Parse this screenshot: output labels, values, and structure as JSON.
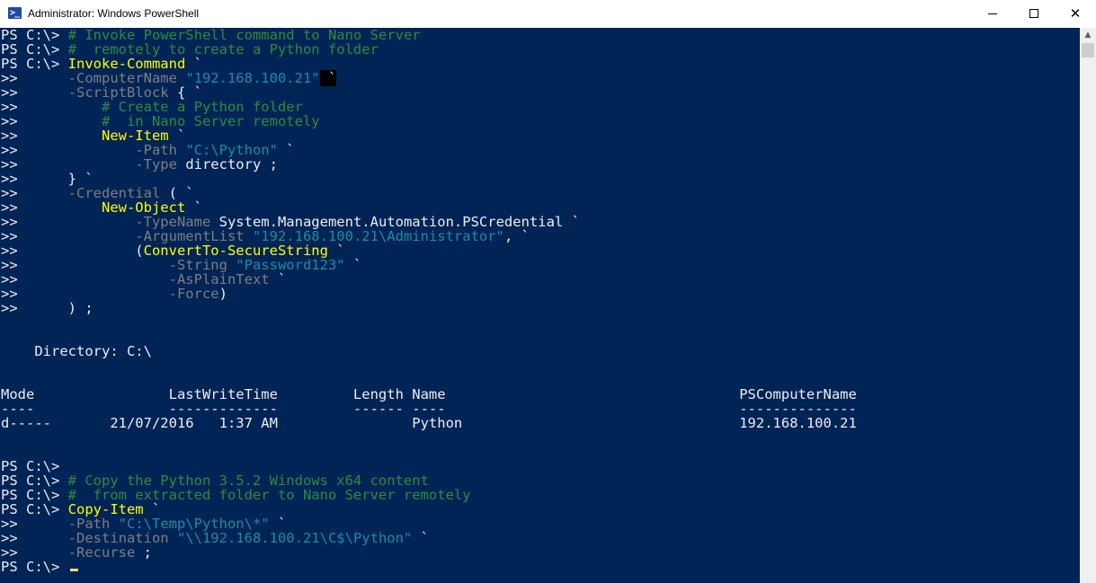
{
  "window": {
    "title": "Administrator: Windows PowerShell",
    "app_icon_glyph": ">_",
    "buttons": {
      "minimize": "minimize",
      "maximize": "maximize",
      "close": "✕"
    }
  },
  "colors": {
    "console_bg": "#012456",
    "default_text": "#eeedf0",
    "comment": "#2e8b3e",
    "command": "#ffff00",
    "parameter": "#7e7e7e",
    "string": "#1e8ba0",
    "cursor": "#eedc82"
  },
  "console": {
    "lines": [
      [
        {
          "t": "PS C:\\> ",
          "c": "def"
        },
        {
          "t": "# Invoke PowerShell command to Nano Server",
          "c": "com"
        }
      ],
      [
        {
          "t": "PS C:\\> ",
          "c": "def"
        },
        {
          "t": "#  remotely to create a Python folder",
          "c": "com"
        }
      ],
      [
        {
          "t": "PS C:\\> ",
          "c": "def"
        },
        {
          "t": "Invoke-Command",
          "c": "cmd"
        },
        {
          "t": " `",
          "c": "def"
        }
      ],
      [
        {
          "t": ">>      ",
          "c": "def"
        },
        {
          "t": "-ComputerName ",
          "c": "par"
        },
        {
          "t": "\"192.168.100.21\"",
          "c": "str"
        },
        {
          "t": " `",
          "c": "def",
          "hi": true
        }
      ],
      [
        {
          "t": ">>      ",
          "c": "def"
        },
        {
          "t": "-ScriptBlock",
          "c": "par"
        },
        {
          "t": " { `",
          "c": "def"
        }
      ],
      [
        {
          "t": ">>          ",
          "c": "def"
        },
        {
          "t": "# Create a Python folder",
          "c": "com"
        }
      ],
      [
        {
          "t": ">>          ",
          "c": "def"
        },
        {
          "t": "#  in Nano Server remotely",
          "c": "com"
        }
      ],
      [
        {
          "t": ">>          ",
          "c": "def"
        },
        {
          "t": "New-Item",
          "c": "cmd"
        },
        {
          "t": " `",
          "c": "def"
        }
      ],
      [
        {
          "t": ">>              ",
          "c": "def"
        },
        {
          "t": "-Path ",
          "c": "par"
        },
        {
          "t": "\"C:\\Python\"",
          "c": "str"
        },
        {
          "t": " `",
          "c": "def"
        }
      ],
      [
        {
          "t": ">>              ",
          "c": "def"
        },
        {
          "t": "-Type ",
          "c": "par"
        },
        {
          "t": "directory ;",
          "c": "def"
        }
      ],
      [
        {
          "t": ">>      } `",
          "c": "def"
        }
      ],
      [
        {
          "t": ">>      ",
          "c": "def"
        },
        {
          "t": "-Credential",
          "c": "par"
        },
        {
          "t": " ( `",
          "c": "def"
        }
      ],
      [
        {
          "t": ">>          ",
          "c": "def"
        },
        {
          "t": "New-Object",
          "c": "cmd"
        },
        {
          "t": " `",
          "c": "def"
        }
      ],
      [
        {
          "t": ">>              ",
          "c": "def"
        },
        {
          "t": "-TypeName ",
          "c": "par"
        },
        {
          "t": "System.Management.Automation.PSCredential `",
          "c": "def"
        }
      ],
      [
        {
          "t": ">>              ",
          "c": "def"
        },
        {
          "t": "-ArgumentList ",
          "c": "par"
        },
        {
          "t": "\"192.168.100.21\\Administrator\"",
          "c": "str"
        },
        {
          "t": ", `",
          "c": "def"
        }
      ],
      [
        {
          "t": ">>              (",
          "c": "def"
        },
        {
          "t": "ConvertTo-SecureString",
          "c": "cmd"
        },
        {
          "t": " `",
          "c": "def"
        }
      ],
      [
        {
          "t": ">>                  ",
          "c": "def"
        },
        {
          "t": "-String ",
          "c": "par"
        },
        {
          "t": "\"Password123\"",
          "c": "str"
        },
        {
          "t": " `",
          "c": "def"
        }
      ],
      [
        {
          "t": ">>                  ",
          "c": "def"
        },
        {
          "t": "-AsPlainText",
          "c": "par"
        },
        {
          "t": " `",
          "c": "def"
        }
      ],
      [
        {
          "t": ">>                  ",
          "c": "def"
        },
        {
          "t": "-Force",
          "c": "par"
        },
        {
          "t": ")",
          "c": "def"
        }
      ],
      [
        {
          "t": ">>      ) ;",
          "c": "def"
        }
      ],
      [],
      [],
      [
        {
          "t": "    Directory: C:\\",
          "c": "def"
        }
      ],
      [],
      [],
      [
        {
          "t": "Mode                LastWriteTime         Length Name                                   PSComputerName",
          "c": "def"
        }
      ],
      [
        {
          "t": "----                -------------         ------ ----                                   --------------",
          "c": "def"
        }
      ],
      [
        {
          "t": "d-----       21/07/2016   1:37 AM                Python                                 192.168.100.21",
          "c": "def"
        }
      ],
      [],
      [],
      [
        {
          "t": "PS C:\\>",
          "c": "def"
        }
      ],
      [
        {
          "t": "PS C:\\> ",
          "c": "def"
        },
        {
          "t": "# Copy the Python 3.5.2 Windows x64 content",
          "c": "com"
        }
      ],
      [
        {
          "t": "PS C:\\> ",
          "c": "def"
        },
        {
          "t": "#  from extracted folder to Nano Server remotely",
          "c": "com"
        }
      ],
      [
        {
          "t": "PS C:\\> ",
          "c": "def"
        },
        {
          "t": "Copy-Item",
          "c": "cmd"
        },
        {
          "t": " `",
          "c": "def"
        }
      ],
      [
        {
          "t": ">>      ",
          "c": "def"
        },
        {
          "t": "-Path ",
          "c": "par"
        },
        {
          "t": "\"C:\\Temp\\Python\\*\"",
          "c": "str"
        },
        {
          "t": " `",
          "c": "def"
        }
      ],
      [
        {
          "t": ">>      ",
          "c": "def"
        },
        {
          "t": "-Destination ",
          "c": "par"
        },
        {
          "t": "\"\\\\192.168.100.21\\C$\\Python\"",
          "c": "str"
        },
        {
          "t": " `",
          "c": "def"
        }
      ],
      [
        {
          "t": ">>      ",
          "c": "def"
        },
        {
          "t": "-Recurse",
          "c": "par"
        },
        {
          "t": " ;",
          "c": "def"
        }
      ],
      [
        {
          "t": "PS C:\\> ",
          "c": "def"
        }
      ]
    ],
    "cursor_on_last_line": true
  },
  "scrollbar": {
    "up_arrow": "▲"
  }
}
